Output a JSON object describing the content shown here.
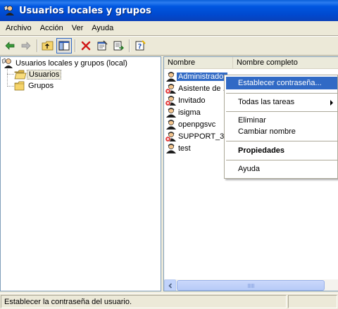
{
  "window": {
    "title": "Usuarios locales y grupos"
  },
  "menubar": {
    "items": [
      "Archivo",
      "Acción",
      "Ver",
      "Ayuda"
    ]
  },
  "toolbar": {
    "buttons": [
      "back-arrow-icon",
      "forward-arrow-icon",
      "up-folder-icon",
      "show-hide-tree-icon",
      "delete-icon",
      "properties-icon",
      "export-list-icon",
      "help-icon"
    ]
  },
  "tree": {
    "root": "Usuarios locales y grupos (local)",
    "children": [
      "Usuarios",
      "Grupos"
    ],
    "selected": "Usuarios"
  },
  "list": {
    "columns": [
      "Nombre",
      "Nombre completo"
    ],
    "rows": [
      {
        "name": "Administrador",
        "disabled": false,
        "selected": true
      },
      {
        "name": "Asistente de ...",
        "disabled": true,
        "selected": false
      },
      {
        "name": "Invitado",
        "disabled": true,
        "selected": false
      },
      {
        "name": "isigma",
        "disabled": false,
        "selected": false
      },
      {
        "name": "openpgsvc",
        "disabled": false,
        "selected": false
      },
      {
        "name": "SUPPORT_38...",
        "disabled": true,
        "selected": false
      },
      {
        "name": "test",
        "disabled": false,
        "selected": false
      }
    ]
  },
  "context_menu": {
    "items": [
      {
        "label": "Establecer contraseña...",
        "hover": true
      },
      {
        "label": "Todas las tareas",
        "submenu": true
      },
      {
        "label": "Eliminar"
      },
      {
        "label": "Cambiar nombre"
      },
      {
        "label": "Propiedades",
        "bold": true
      },
      {
        "label": "Ayuda"
      }
    ]
  },
  "statusbar": {
    "text": "Establecer la contraseña del usuario."
  },
  "colors": {
    "titlebar": "#0049cf",
    "selection": "#316ac5",
    "chrome": "#ece9d8"
  }
}
